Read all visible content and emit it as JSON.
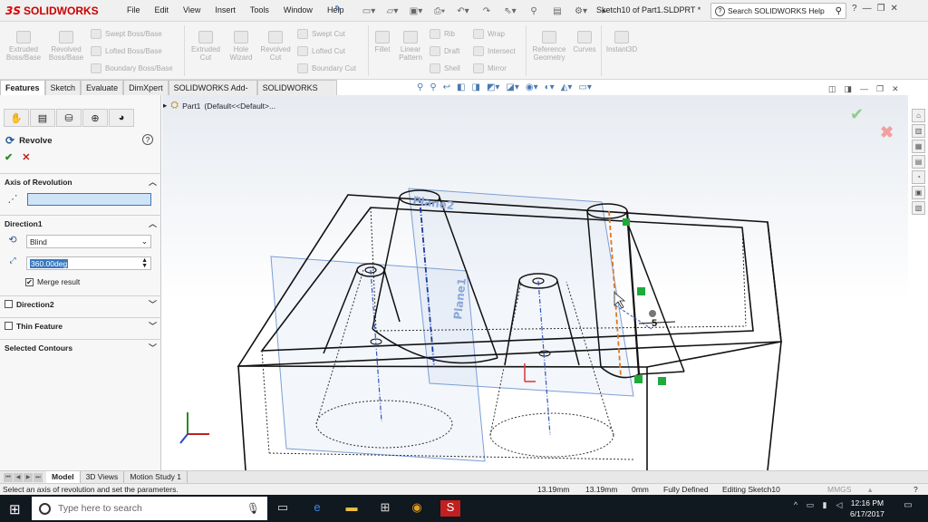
{
  "app": {
    "brand_prefix": "3S",
    "brand": "SOLIDWORKS",
    "menu": [
      "File",
      "Edit",
      "View",
      "Insert",
      "Tools",
      "Window",
      "Help"
    ],
    "document_title": "Sketch10 of Part1.SLDPRT *",
    "help_search_placeholder": "Search SOLIDWORKS Help",
    "help_label": "?"
  },
  "ribbon": {
    "big_buttons": [
      {
        "label": "Extruded Boss/Base"
      },
      {
        "label": "Revolved Boss/Base"
      },
      {
        "label": "Extruded Cut"
      },
      {
        "label": "Hole Wizard"
      },
      {
        "label": "Revolved Cut"
      },
      {
        "label": "Fillet"
      },
      {
        "label": "Linear Pattern"
      },
      {
        "label": "Reference Geometry"
      },
      {
        "label": "Curves"
      },
      {
        "label": "Instant3D"
      }
    ],
    "small_buttons": [
      {
        "label": "Swept Boss/Base"
      },
      {
        "label": "Lofted Boss/Base"
      },
      {
        "label": "Boundary Boss/Base"
      },
      {
        "label": "Swept Cut"
      },
      {
        "label": "Lofted Cut"
      },
      {
        "label": "Boundary Cut"
      },
      {
        "label": "Rib"
      },
      {
        "label": "Draft"
      },
      {
        "label": "Shell"
      },
      {
        "label": "Wrap"
      },
      {
        "label": "Intersect"
      },
      {
        "label": "Mirror"
      }
    ]
  },
  "tabs": [
    "Features",
    "Sketch",
    "Evaluate",
    "DimXpert",
    "SOLIDWORKS Add-Ins",
    "SOLIDWORKS MBD"
  ],
  "property_manager": {
    "title": "Revolve",
    "sections": {
      "axis": "Axis of Revolution",
      "direction1": "Direction1",
      "direction2": "Direction2",
      "thin": "Thin Feature",
      "contours": "Selected Contours"
    },
    "end_condition": "Blind",
    "angle": "360.00deg",
    "merge_result": "Merge result"
  },
  "tree": {
    "root": "Part1",
    "config": "(Default<<Default>..."
  },
  "viewport": {
    "plane_labels": [
      "Plane2",
      "Plane1"
    ],
    "dimension": "5"
  },
  "bottom_tabs": [
    "Model",
    "3D Views",
    "Motion Study 1"
  ],
  "status": {
    "message": "Select an axis of revolution and set the parameters.",
    "x": "13.19mm",
    "y": "13.19mm",
    "z": "0mm",
    "state": "Fully Defined",
    "editing": "Editing Sketch10",
    "units": "MMGS"
  },
  "taskbar": {
    "search_placeholder": "Type here to search",
    "time": "12:16 PM",
    "date": "6/17/2017"
  }
}
